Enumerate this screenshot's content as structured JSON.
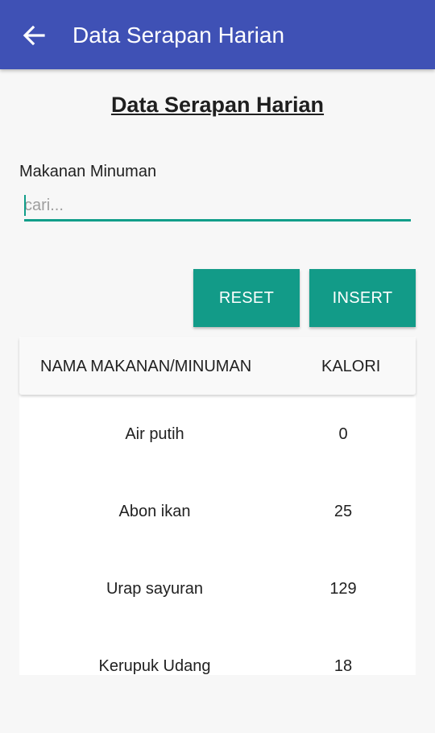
{
  "appbar": {
    "title": "Data Serapan Harian",
    "back_icon": "arrow-left-icon"
  },
  "page": {
    "heading": "Data Serapan Harian"
  },
  "search": {
    "label": "Makanan Minuman",
    "placeholder": "cari...",
    "value": ""
  },
  "buttons": {
    "reset": "RESET",
    "insert": "INSERT"
  },
  "table": {
    "headers": {
      "name": "NAMA MAKANAN/MINUMAN",
      "kalori": "KALORI"
    },
    "rows": [
      {
        "name": "Air putih",
        "kalori": "0"
      },
      {
        "name": "Abon ikan",
        "kalori": "25"
      },
      {
        "name": "Urap sayuran",
        "kalori": "129"
      },
      {
        "name": "Kerupuk Udang",
        "kalori": "18"
      }
    ]
  },
  "colors": {
    "appbar": "#3f51b5",
    "accent": "#129b88",
    "background": "#f7f7f7"
  }
}
